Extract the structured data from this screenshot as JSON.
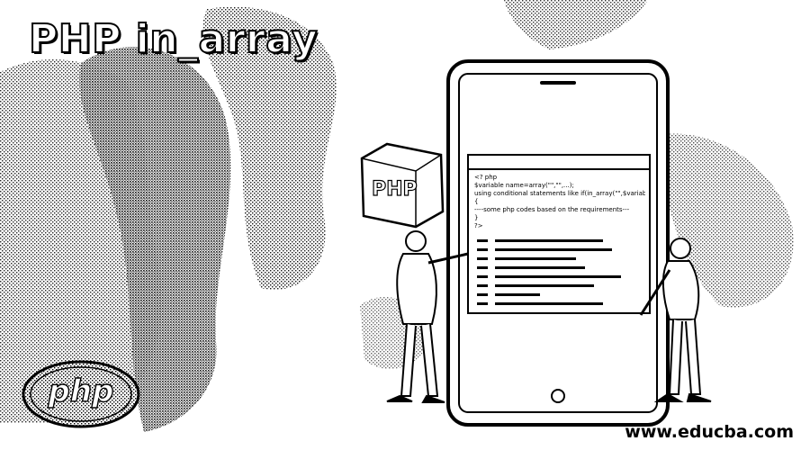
{
  "title": "PHP in_array",
  "badge_text": "PHP",
  "logo_text": "php",
  "code_lines": [
    "<? php",
    "$variable name=array(\"\",\"\",...);",
    "using conditional statements like if(in_array(\"\",$variable name))",
    "{",
    "----some php codes based on the requirements---",
    "}",
    "?>"
  ],
  "watermark": "www.educba.com",
  "colors": {
    "background": "#ffffff",
    "ink": "#000000"
  }
}
